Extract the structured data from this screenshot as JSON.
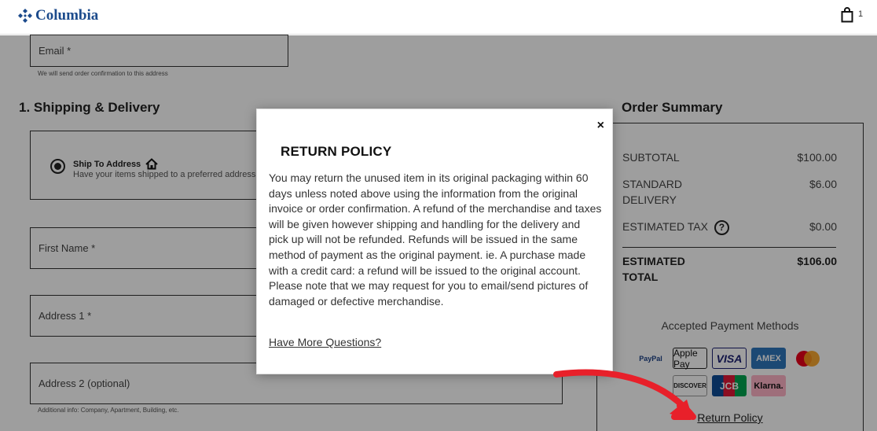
{
  "header": {
    "brand": "Columbia",
    "cart_count": "1"
  },
  "form": {
    "email_label": "Email *",
    "email_helper": "We will send order confirmation to this address",
    "section_title": "1. Shipping & Delivery",
    "ship_option_title": "Ship To Address",
    "ship_option_desc": "Have your items shipped to a preferred address",
    "first_name_label": "First Name *",
    "address1_label": "Address 1 *",
    "address2_label": "Address 2 (optional)",
    "address2_helper": "Additional info: Company, Apartment, Building, etc."
  },
  "summary": {
    "title": "Order Summary",
    "subtotal_label": "SUBTOTAL",
    "subtotal_value": "$100.00",
    "delivery_label_1": "STANDARD",
    "delivery_label_2": "DELIVERY",
    "delivery_value": "$6.00",
    "tax_label": "ESTIMATED TAX",
    "tax_value": "$0.00",
    "total_label_1": "ESTIMATED",
    "total_label_2": "TOTAL",
    "total_value": "$106.00",
    "payment_title": "Accepted Payment Methods",
    "payment_methods": [
      "PayPal",
      "Apple Pay",
      "VISA",
      "AMEX",
      "Mastercard",
      "DISCOVER",
      "JCB",
      "Klarna."
    ],
    "return_policy_link": "Return Policy"
  },
  "modal": {
    "title": "RETURN POLICY",
    "body": "You may return the unused item in its original packaging within 60 days unless noted above using the information from the original invoice or order confirmation. A refund of the merchandise and taxes will be given however shipping and handling for the delivery and pick up will not be refunded. Refunds will be issued in the same method of payment as the original payment. ie. A purchase made with a credit card: a refund will be issued to the original account. Please note that we may request for you to email/send pictures of damaged or defective merchandise.",
    "link": "Have More Questions?",
    "close": "×"
  },
  "colors": {
    "brand_blue": "#1c4b8c",
    "annotation_red": "#e8202a",
    "overlay": "rgba(0,0,0,0.38)"
  }
}
